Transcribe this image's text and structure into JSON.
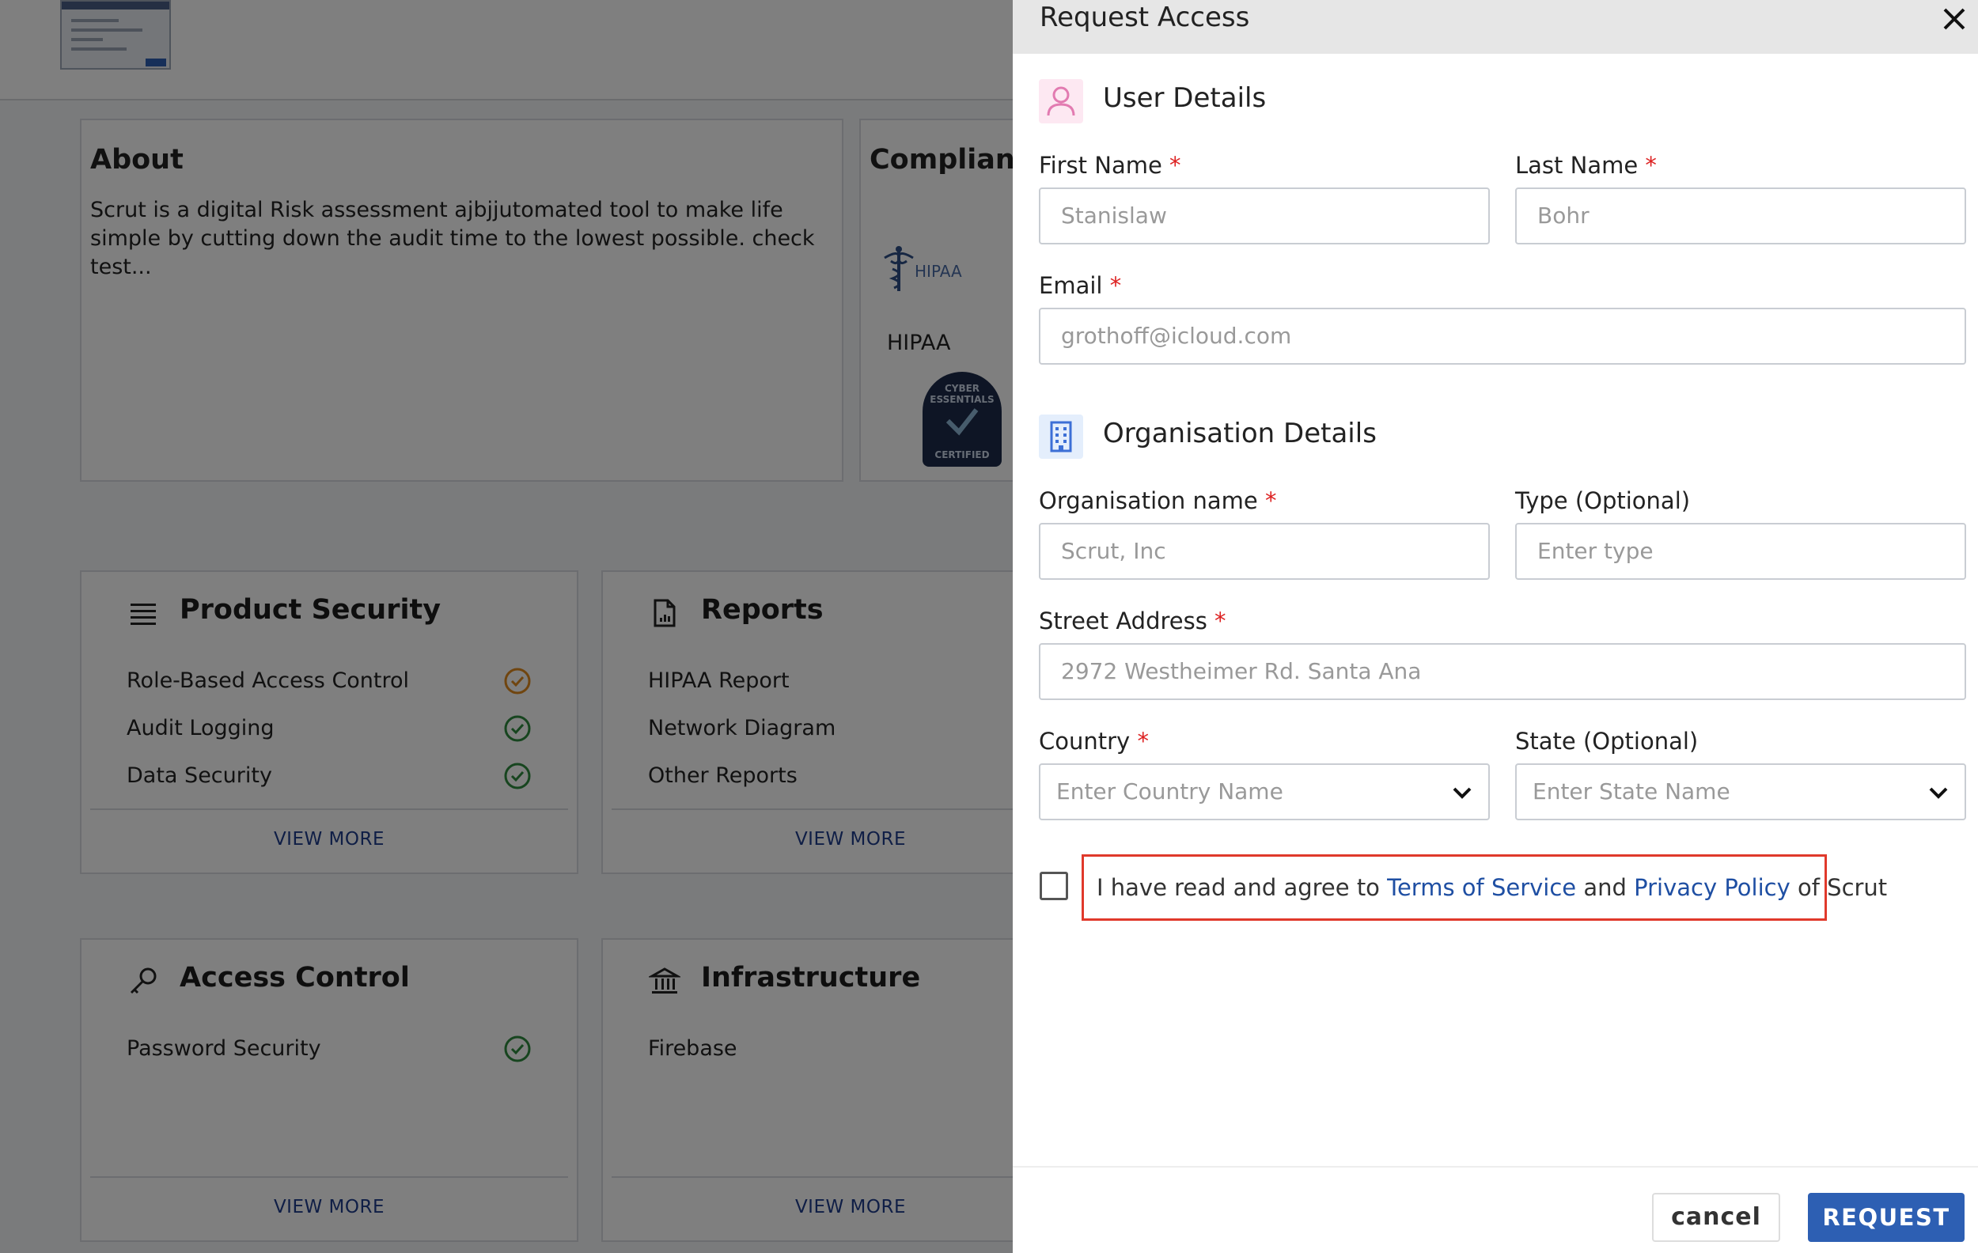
{
  "background": {
    "about": {
      "heading": "About",
      "text": "Scrut is a digital Risk assessment ajbjjutomated tool to make life simple by cutting down the audit time to the lowest possible. check test..."
    },
    "compliance": {
      "heading": "Compliance",
      "items": [
        {
          "label": "HIPAA",
          "logo_text": "HIPAA"
        },
        {
          "badge_top": "CYBER ESSENTIALS",
          "badge_bottom": "CERTIFIED"
        }
      ]
    },
    "sections": [
      {
        "title": "Product Security",
        "icon": "list-icon",
        "items": [
          {
            "label": "Role-Based Access Control",
            "status_color": "#e08a1e"
          },
          {
            "label": "Audit Logging",
            "status_color": "#2e8b3e"
          },
          {
            "label": "Data Security",
            "status_color": "#2e8b3e"
          }
        ],
        "view_more": "VIEW MORE"
      },
      {
        "title": "Reports",
        "icon": "document-icon",
        "items": [
          {
            "label": "HIPAA Report"
          },
          {
            "label": "Network Diagram"
          },
          {
            "label": "Other Reports"
          }
        ],
        "view_more": "VIEW MORE"
      },
      {
        "title": "Access Control",
        "icon": "key-icon",
        "items": [
          {
            "label": "Password Security",
            "status_color": "#2e8b3e"
          }
        ],
        "view_more": "VIEW MORE"
      },
      {
        "title": "Infrastructure",
        "icon": "bank-icon",
        "items": [
          {
            "label": "Firebase"
          }
        ],
        "view_more": "VIEW MORE"
      }
    ]
  },
  "modal": {
    "title": "Request Access",
    "user_details": {
      "heading": "User Details",
      "first_name": {
        "label": "First Name",
        "required": "*",
        "placeholder": "Stanislaw"
      },
      "last_name": {
        "label": "Last Name",
        "required": "*",
        "placeholder": "Bohr"
      },
      "email": {
        "label": "Email",
        "required": "*",
        "placeholder": "grothoff@icloud.com"
      }
    },
    "organisation_details": {
      "heading": "Organisation Details",
      "org_name": {
        "label": "Organisation name",
        "required": "*",
        "placeholder": "Scrut, Inc"
      },
      "type": {
        "label": "Type (Optional)",
        "placeholder": "Enter type"
      },
      "street": {
        "label": "Street Address",
        "required": "*",
        "placeholder": "2972 Westheimer Rd. Santa Ana"
      },
      "country": {
        "label": "Country",
        "required": "*",
        "placeholder": "Enter Country Name"
      },
      "state": {
        "label": "State (Optional)",
        "placeholder": "Enter State Name"
      }
    },
    "agreement": {
      "prefix": "I have read and agree to ",
      "terms": "Terms of Service",
      "mid": " and ",
      "privacy": "Privacy Policy",
      "suffix": " of Scrut"
    },
    "buttons": {
      "cancel": "cancel",
      "request": "REQUEST"
    },
    "colors": {
      "accent": "#2d5fb3",
      "required": "#dd2222",
      "highlight": "#e0392b",
      "user_icon": "#e27bb1",
      "org_icon": "#3c6fd6"
    }
  }
}
